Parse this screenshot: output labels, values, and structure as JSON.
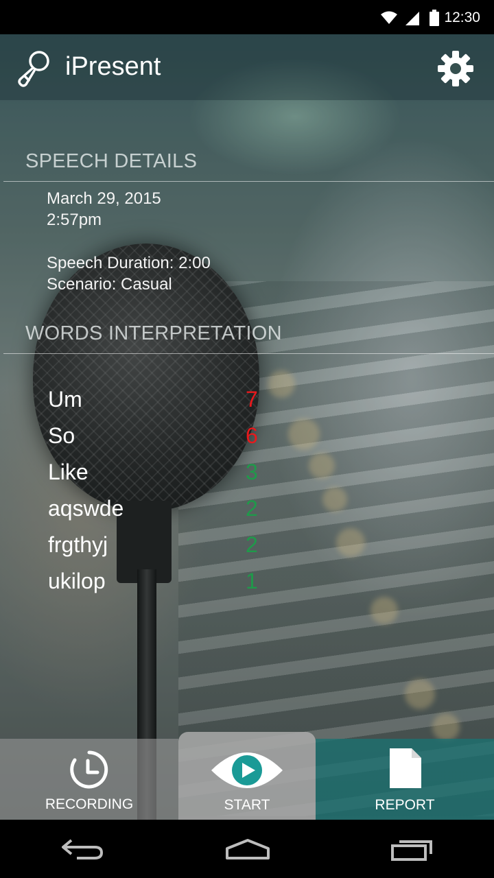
{
  "status_bar": {
    "time": "12:30"
  },
  "app_bar": {
    "title": "iPresent"
  },
  "speech_details": {
    "heading": "SPEECH DETAILS",
    "date": "March 29, 2015",
    "time": "2:57pm",
    "duration": "Speech Duration: 2:00",
    "scenario": "Scenario: Casual"
  },
  "words_interpretation": {
    "heading": "WORDS INTERPRETATION",
    "rows": [
      {
        "word": "Um",
        "count": "7",
        "color": "#e8191c"
      },
      {
        "word": "So",
        "count": "6",
        "color": "#e8191c"
      },
      {
        "word": "Like",
        "count": "3",
        "color": "#1f9a4a"
      },
      {
        "word": "aqswde",
        "count": "2",
        "color": "#1f9a4a"
      },
      {
        "word": "frgthyj",
        "count": "2",
        "color": "#1f9a4a"
      },
      {
        "word": "ukilop",
        "count": "1",
        "color": "#1f9a4a"
      }
    ]
  },
  "tabs": {
    "recording": "RECORDING",
    "start": "START",
    "report": "REPORT",
    "accent_color": "#1a9a96"
  },
  "icons": {
    "app_logo": "microphone-outline-icon",
    "settings": "gear-icon",
    "recording": "clock-icon",
    "start": "eye-play-icon",
    "report": "document-icon",
    "nav_back": "back-icon",
    "nav_home": "home-icon",
    "nav_recents": "recents-icon"
  }
}
